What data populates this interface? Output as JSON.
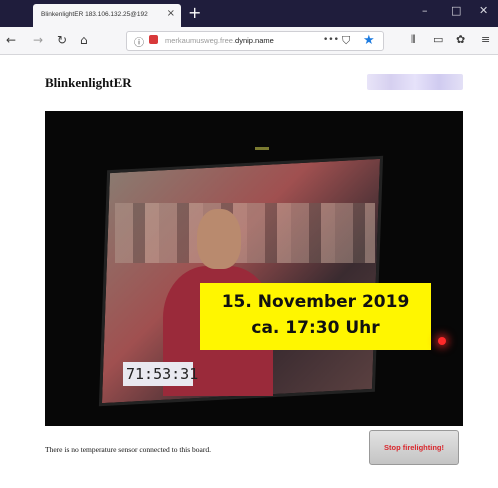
{
  "browser": {
    "tab_title": "BlinkenlightER 183.106.132.25@192",
    "tab_close": "×",
    "new_tab": "+",
    "url_prefix": "merkaumusweg.free.",
    "url_host": "dynip.name",
    "url_more": "•••",
    "icons": {
      "back": "←",
      "forward": "→",
      "reload": "↻",
      "home": "⌂",
      "library": "⫴",
      "sidebar": "▭",
      "extension": "✿",
      "menu": "≡",
      "minimize": "–",
      "maximize": "□",
      "close": "✕",
      "star": "★",
      "pocket": "⛉",
      "lock": "ⓘ"
    }
  },
  "page": {
    "title": "BlinkenlightER",
    "video": {
      "overlay_line1": "15. November 2019",
      "overlay_line2": "ca. 17:30 Uhr",
      "timecode": "71:53:31"
    },
    "temperature_message": "There is no temperature sensor connected to this board.",
    "stop_button_label": "Stop firelighting!"
  },
  "colors": {
    "tabstrip": "#1f1d3c",
    "overlay": "#fff600",
    "stop_text": "#d9272d",
    "star": "#1c7be0"
  }
}
